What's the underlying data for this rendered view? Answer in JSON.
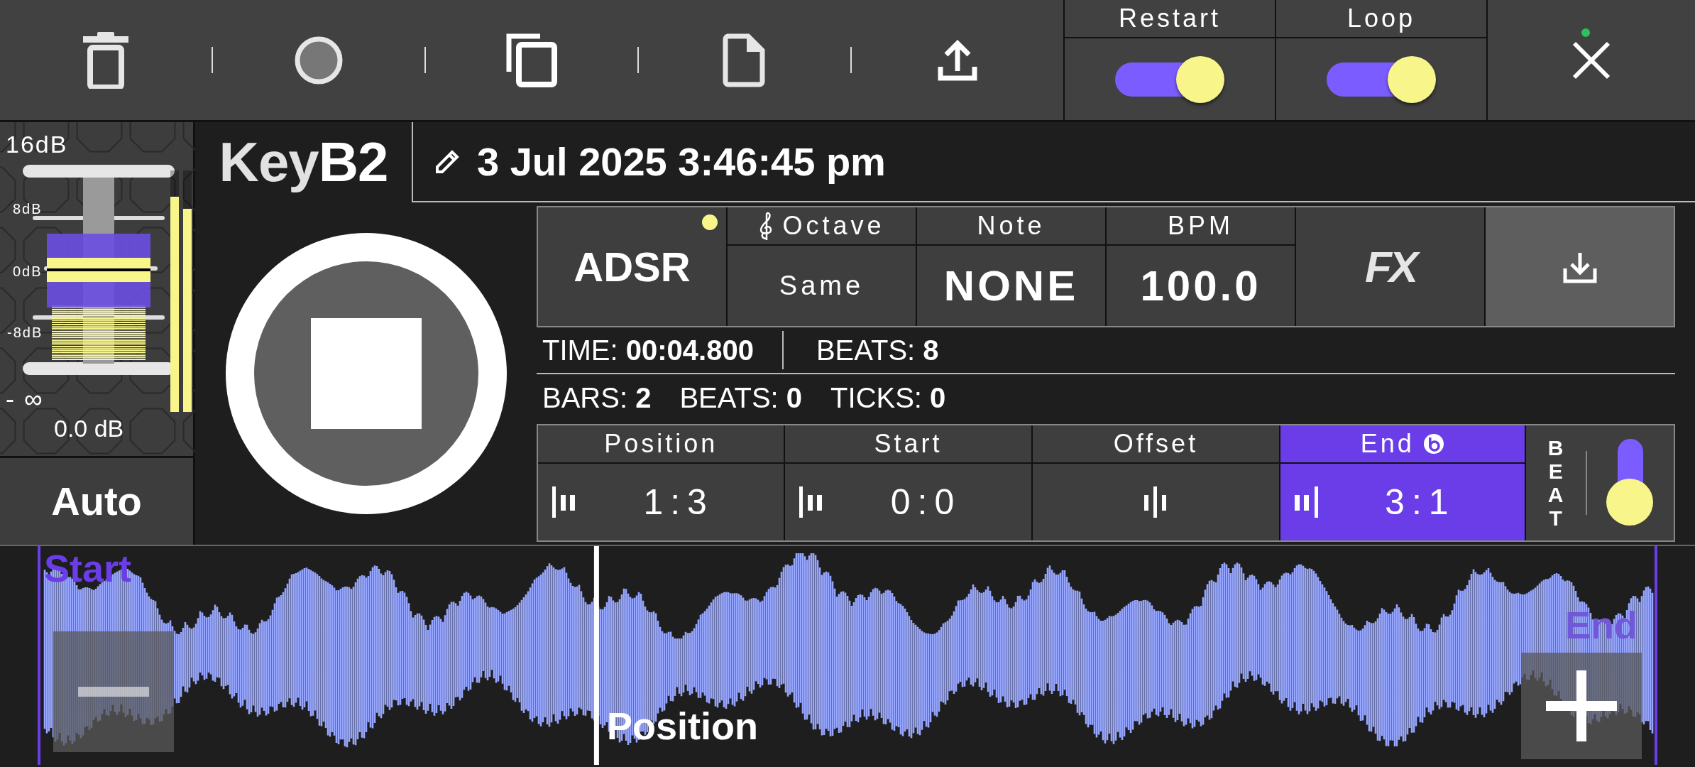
{
  "toggles": [
    {
      "label": "Restart",
      "on": true
    },
    {
      "label": "Loop",
      "on": true
    }
  ],
  "close_button": {
    "status_dot": true
  },
  "meter": {
    "scale": [
      "16dB",
      "8dB",
      "0dB",
      "-8dB",
      "- ∞"
    ],
    "reading": "0.0 dB",
    "fader": {
      "level": 0.5
    },
    "channels": [
      {
        "level": 0.89
      },
      {
        "level": 0.84
      }
    ]
  },
  "mode_button": "Auto",
  "title": {
    "prefix": "Key",
    "name": "B2"
  },
  "date": "3 Jul 2025 3:46:45 pm",
  "adsr": {
    "label": "ADSR",
    "active": true
  },
  "fields": [
    {
      "label": "Octave",
      "value": "Same",
      "kind": "clef"
    },
    {
      "label": "Note",
      "value": "NONE",
      "kind": "plain"
    },
    {
      "label": "BPM",
      "value": "100.0",
      "kind": "plain"
    }
  ],
  "fx_button": "FX",
  "stats": [
    [
      "TIME: **00:04.800**",
      "BEATS: **8**"
    ],
    [
      "BARS: **2**",
      "BEATS: **0**",
      "TICKS: **0**"
    ]
  ],
  "markers": [
    {
      "label": "Position",
      "value": "1:3",
      "kind": "left",
      "selected": false,
      "beat_badge": false
    },
    {
      "label": "Start",
      "value": "0:0",
      "kind": "left",
      "selected": false,
      "beat_badge": false
    },
    {
      "label": "Offset",
      "kind": "center",
      "selected": false,
      "beat_badge": false
    },
    {
      "label": "End",
      "value": "3:1",
      "kind": "right",
      "selected": true,
      "beat_badge": true
    }
  ],
  "beat_toggle": {
    "label": "BEAT",
    "on": true
  },
  "waveform": {
    "start_label": "Start",
    "end_label": "End",
    "playhead": {
      "label": "Position",
      "level": 0.345
    }
  }
}
